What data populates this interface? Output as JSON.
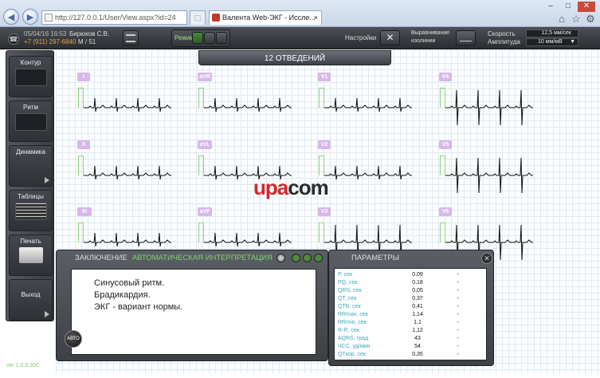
{
  "browser": {
    "url": "http://127.0.0.1/User/View.aspx?id=24",
    "tab_title": "Валента Web-ЭКГ - Иссле...",
    "tab_close": "×",
    "win_min": "–",
    "win_max": "□",
    "win_close": "✕"
  },
  "patient": {
    "date": "05/04/16 16:53",
    "name": "Бирюков С.В.",
    "phone": "+7 (911) 297-6840",
    "sex_age": "М / 51"
  },
  "toolbar": {
    "mode_label": "Режим",
    "settings_label": "Настройки",
    "isoline_label_1": "Выравнивание",
    "isoline_label_2": "изолинии",
    "speed_label": "Скорость",
    "speed_value": "12,5 мм/сек",
    "amp_label": "Амплитуда",
    "amp_value": "10 мм/мВ"
  },
  "sidebar": {
    "items": [
      {
        "label": "Контур"
      },
      {
        "label": "Ритм"
      },
      {
        "label": "Динамика"
      },
      {
        "label": "Таблицы"
      },
      {
        "label": "Печать"
      },
      {
        "label": "Выход"
      }
    ]
  },
  "ecg": {
    "title": "12 ОТВЕДЕНИЙ",
    "leads": [
      "I",
      "aVR",
      "V1",
      "V4",
      "II",
      "aVL",
      "V2",
      "V5",
      "III",
      "aVF",
      "V3",
      "V6"
    ]
  },
  "logo": {
    "part1": "upa",
    "part2": "com",
    "color1": "#d7252b",
    "color2": "#2b2b2b"
  },
  "conclusion": {
    "title": "ЗАКЛЮЧЕНИЕ",
    "subtitle": "АВТОМАТИЧЕСКАЯ ИНТЕРПРЕТАЦИЯ",
    "lines": [
      "Синусовый ритм.",
      "Брадикардия.",
      "ЭКГ - вариант нормы."
    ],
    "auto_button": "АВТО"
  },
  "parameters": {
    "title": "ПАРАМЕТРЫ",
    "rows": [
      {
        "name": "P, сек",
        "value": "0,09",
        "dash": "-"
      },
      {
        "name": "PQ, сек",
        "value": "0,18",
        "dash": "-"
      },
      {
        "name": "QRS, сек",
        "value": "0,05",
        "dash": "-"
      },
      {
        "name": "QT, сек",
        "value": "0,37",
        "dash": "-"
      },
      {
        "name": "QTБ, сек",
        "value": "0,41",
        "dash": "-"
      },
      {
        "name": "RRmax, сек",
        "value": "1,14",
        "dash": "-"
      },
      {
        "name": "RRmin, сек",
        "value": "1,1",
        "dash": "-"
      },
      {
        "name": "R-R, сек",
        "value": "1,12",
        "dash": "-"
      },
      {
        "name": "AQRS, град",
        "value": "43",
        "dash": "-"
      },
      {
        "name": "ЧСС, уд/мин",
        "value": "54",
        "dash": "-"
      },
      {
        "name": "QTкор, сек",
        "value": "0,35",
        "dash": "-"
      }
    ]
  },
  "version": "ver 1.0.0.300"
}
